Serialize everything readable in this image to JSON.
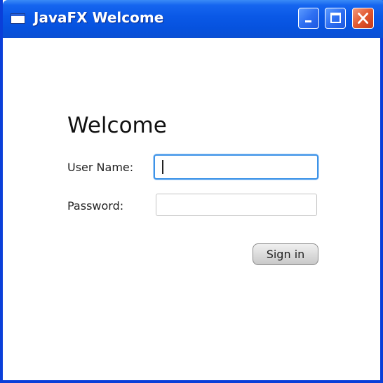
{
  "window": {
    "title": "JavaFX Welcome",
    "controls": {
      "minimize_icon": "minimize-icon",
      "maximize_icon": "maximize-icon",
      "close_icon": "close-icon"
    },
    "accent_color": "#0a58e6",
    "close_color": "#e2582f"
  },
  "form": {
    "heading": "Welcome",
    "username_label": "User Name:",
    "username_value": "",
    "password_label": "Password:",
    "password_value": "",
    "signin_label": "Sign in",
    "focus_color": "#3d93e8"
  }
}
